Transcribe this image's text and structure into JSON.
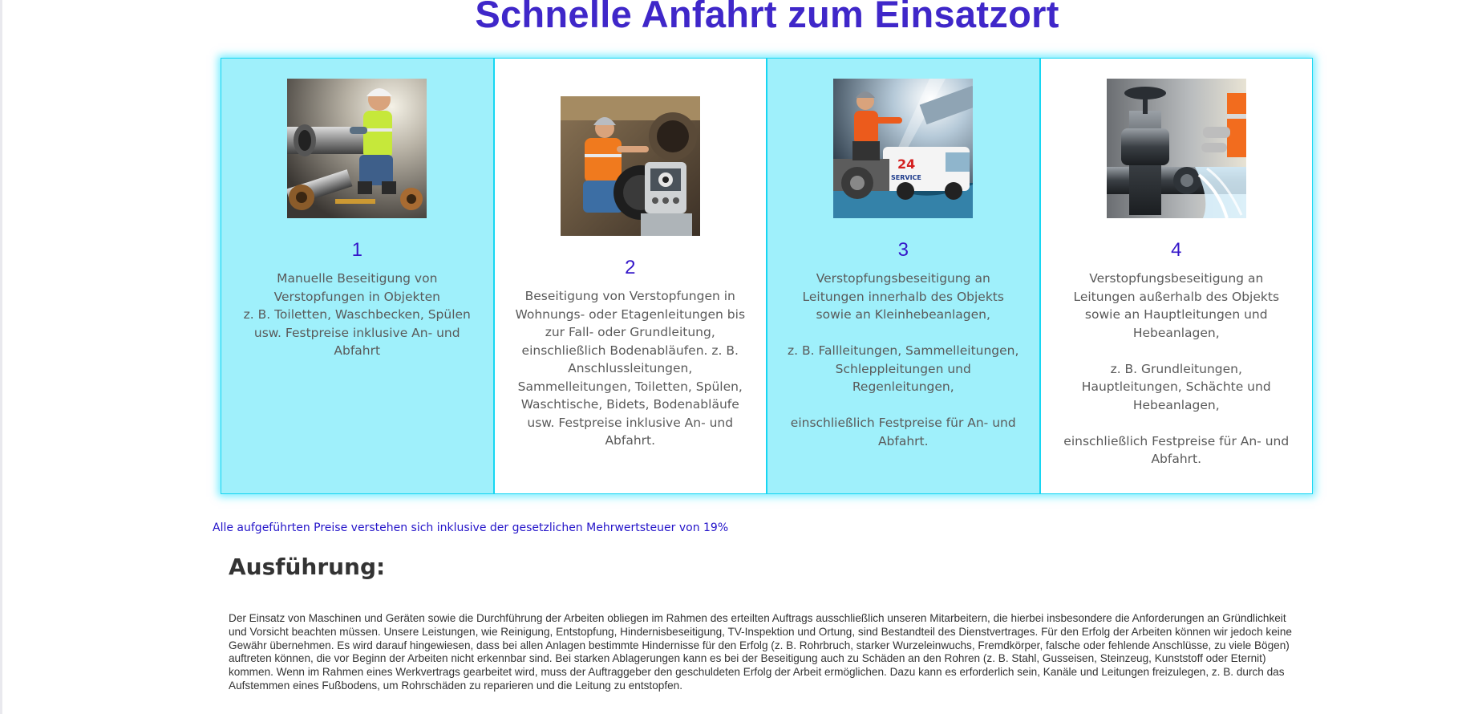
{
  "header": {
    "title": "Schnelle Anfahrt zum Einsatzort"
  },
  "cards": [
    {
      "number": "1",
      "text": "Manuelle Beseitigung von Verstopfungen in Objekten\nz. B. Toiletten, Waschbecken, Spülen usw. Festpreise inklusive An- und Abfahrt",
      "theme": "cyan"
    },
    {
      "number": "2",
      "text": "Beseitigung von Verstopfungen in Wohnungs- oder Etagenleitungen bis zur Fall- oder Grundleitung, einschließlich Bodenabläufen. z. B. Anschlussleitungen, Sammelleitungen, Toiletten, Spülen, Waschtische, Bidets, Bodenabläufe usw. Festpreise inklusive An- und Abfahrt.",
      "theme": "white"
    },
    {
      "number": "3",
      "text": "Verstopfungsbeseitigung an Leitungen innerhalb des Objekts sowie an Kleinhebeanlagen,\n\nz. B. Fallleitungen, Sammelleitungen, Schleppleitungen und Regenleitungen,\n\neinschließlich Festpreise für An- und Abfahrt.",
      "theme": "cyan",
      "van_label_1": "24",
      "van_label_2": "SERVICE"
    },
    {
      "number": "4",
      "text": "Verstopfungsbeseitigung an Leitungen außerhalb des Objekts sowie an Hauptleitungen und Hebeanlagen,\n\nz. B. Grundleitungen, Hauptleitungen, Schächte und Hebeanlagen,\n\neinschließlich Festpreise für An- und Abfahrt.",
      "theme": "white"
    }
  ],
  "tax_note": "Alle aufgeführten Preise verstehen sich inklusive der gesetzlichen Mehrwertsteuer von 19%",
  "section": {
    "heading": "Ausführung:",
    "body": "Der Einsatz von Maschinen und Geräten sowie die Durchführung der Arbeiten obliegen im Rahmen des erteilten Auftrags ausschließlich unseren Mitarbeitern, die hierbei insbesondere die Anforderungen an Gründlichkeit und Vorsicht beachten müssen. Unsere Leistungen, wie Reinigung, Entstopfung, Hindernisbeseitigung, TV-Inspektion und Ortung, sind Bestandteil des Dienstvertrages. Für den Erfolg der Arbeiten können wir jedoch keine Gewähr übernehmen. Es wird darauf hingewiesen, dass bei allen Anlagen bestimmte Hindernisse für den Erfolg (z. B. Rohrbruch, starker Wurzeleinwuchs, Fremdkörper, falsche oder fehlende Anschlüsse, zu viele Bögen) auftreten können, die vor Beginn der Arbeiten nicht erkennbar sind. Bei starken Ablagerungen kann es bei der Beseitigung auch zu Schäden an den Rohren (z. B. Stahl, Gusseisen, Steinzeug, Kunststoff oder Eternit) kommen. Wenn im Rahmen eines Werkvertrags gearbeitet wird, muss der Auftraggeber den geschuldeten Erfolg der Arbeit ermöglichen. Dazu kann es erforderlich sein, Kanäle und Leitungen freizulegen, z. B. durch das Aufstemmen eines Fußbodens, um Rohrschäden zu reparieren und die Leitung zu entstopfen."
  },
  "colors": {
    "title": "#3f27c9",
    "card_cyan": "#9ff0fb",
    "card_border": "#17d6f2",
    "card_number": "#3517c9",
    "tax_note": "#2414c9",
    "body_text": "#333333"
  }
}
